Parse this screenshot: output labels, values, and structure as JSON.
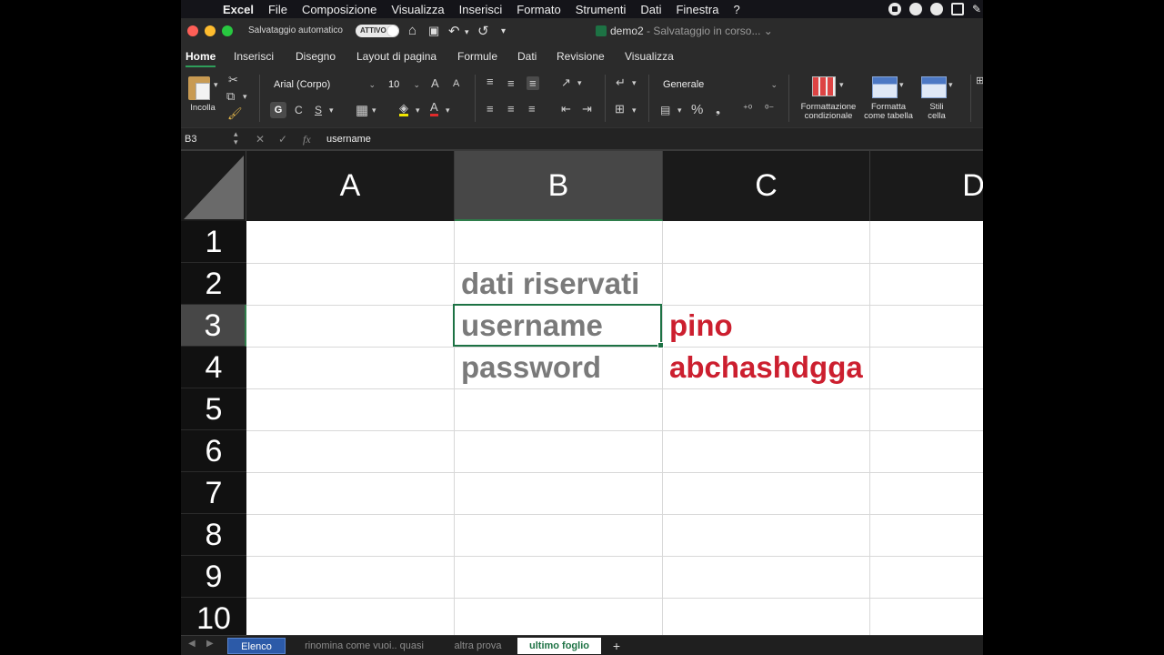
{
  "menubar": {
    "app": "Excel",
    "items": [
      "File",
      "Composizione",
      "Visualizza",
      "Inserisci",
      "Formato",
      "Strumenti",
      "Dati",
      "Finestra",
      "?"
    ]
  },
  "titlebar": {
    "autosave_label": "Salvataggio automatico",
    "autosave_state": "ATTIVO",
    "doc_name": "demo2",
    "doc_status": "- Salvataggio in corso..."
  },
  "ribbon_tabs": [
    "Home",
    "Inserisci",
    "Disegno",
    "Layout di pagina",
    "Formule",
    "Dati",
    "Revisione",
    "Visualizza"
  ],
  "ribbon": {
    "paste_label": "Incolla",
    "font_name": "Arial (Corpo)",
    "font_size": "10",
    "bold": "G",
    "italic": "C",
    "underline": "S",
    "number_format": "Generale",
    "percent": "%",
    "conditional_label_1": "Formattazione",
    "conditional_label_2": "condizionale",
    "table_label_1": "Formatta",
    "table_label_2": "come tabella",
    "styles_label_1": "Stili",
    "styles_label_2": "cella"
  },
  "formula_bar": {
    "name_box": "B3",
    "fx": "fx",
    "content": "username"
  },
  "columns": [
    "A",
    "B",
    "C",
    "D"
  ],
  "rows": [
    "1",
    "2",
    "3",
    "4",
    "5",
    "6",
    "7",
    "8",
    "9",
    "10"
  ],
  "cells": {
    "B2": "dati riservati",
    "B3": "username",
    "B4": "password",
    "C3": "pino",
    "C4": "abchashdgga"
  },
  "sheet_tabs": {
    "tabs": [
      "Elenco",
      "rinomina come vuoi.. quasi",
      "altra prova",
      "ultimo foglio"
    ],
    "active": "ultimo foglio",
    "add": "+"
  },
  "colors": {
    "accent_green": "#1d7244",
    "text_red": "#cc1f2f",
    "text_gray": "#7a7a7a",
    "tab_blue": "#2c5aa8"
  }
}
